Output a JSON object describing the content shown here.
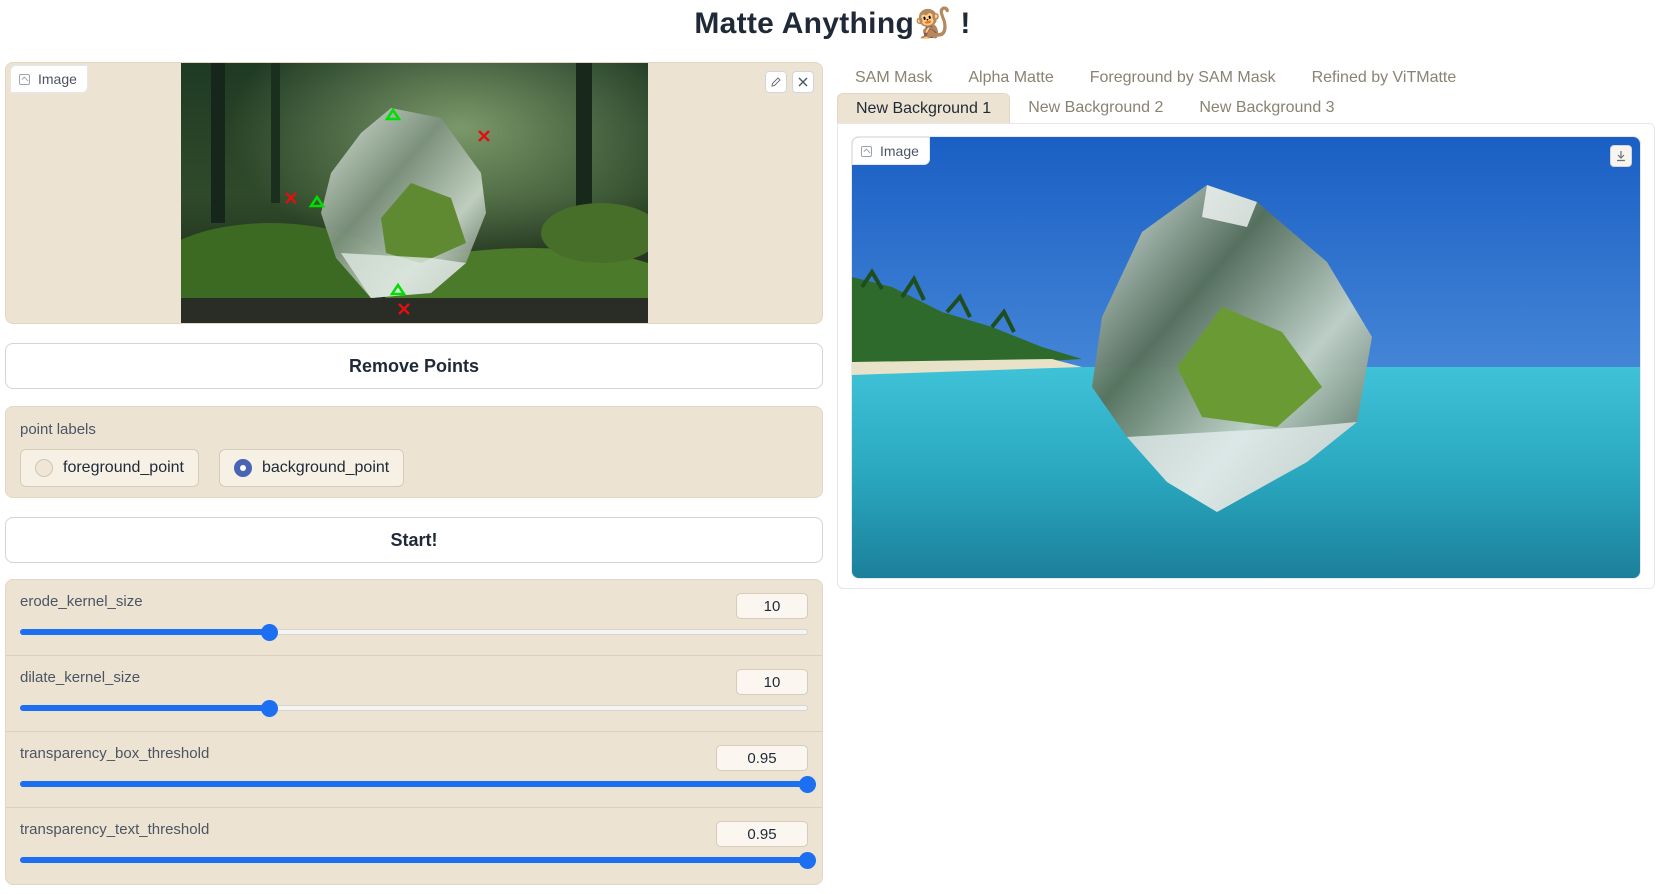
{
  "app": {
    "title": "Matte Anything🐒 !"
  },
  "input_image": {
    "label": "Image",
    "edit_icon": "pencil-icon",
    "close_icon": "close-icon",
    "points": {
      "foreground": 3,
      "background": 3
    }
  },
  "buttons": {
    "remove_points": "Remove Points",
    "start": "Start!"
  },
  "point_labels": {
    "title": "point labels",
    "options": [
      {
        "label": "foreground_point",
        "selected": false
      },
      {
        "label": "background_point",
        "selected": true
      }
    ]
  },
  "sliders": [
    {
      "name": "erode_kernel_size",
      "value": "10",
      "fraction": 0.315
    },
    {
      "name": "dilate_kernel_size",
      "value": "10",
      "fraction": 0.315
    },
    {
      "name": "transparency_box_threshold",
      "value": "0.95",
      "fraction": 1.0
    },
    {
      "name": "transparency_text_threshold",
      "value": "0.95",
      "fraction": 1.0
    }
  ],
  "output": {
    "tabs_row1": [
      "SAM Mask",
      "Alpha Matte",
      "Foreground by SAM Mask",
      "Refined by ViTMatte"
    ],
    "tabs_row2": [
      "New Background 1",
      "New Background 2",
      "New Background 3"
    ],
    "active_tab": "New Background 1",
    "image_label": "Image",
    "download_icon": "download-icon"
  },
  "colors": {
    "accent": "#1d6ff2",
    "panel": "#ede3d3",
    "radio_selected": "#4a64b4",
    "fg_point": "#00e000",
    "bg_point": "#e01010"
  }
}
